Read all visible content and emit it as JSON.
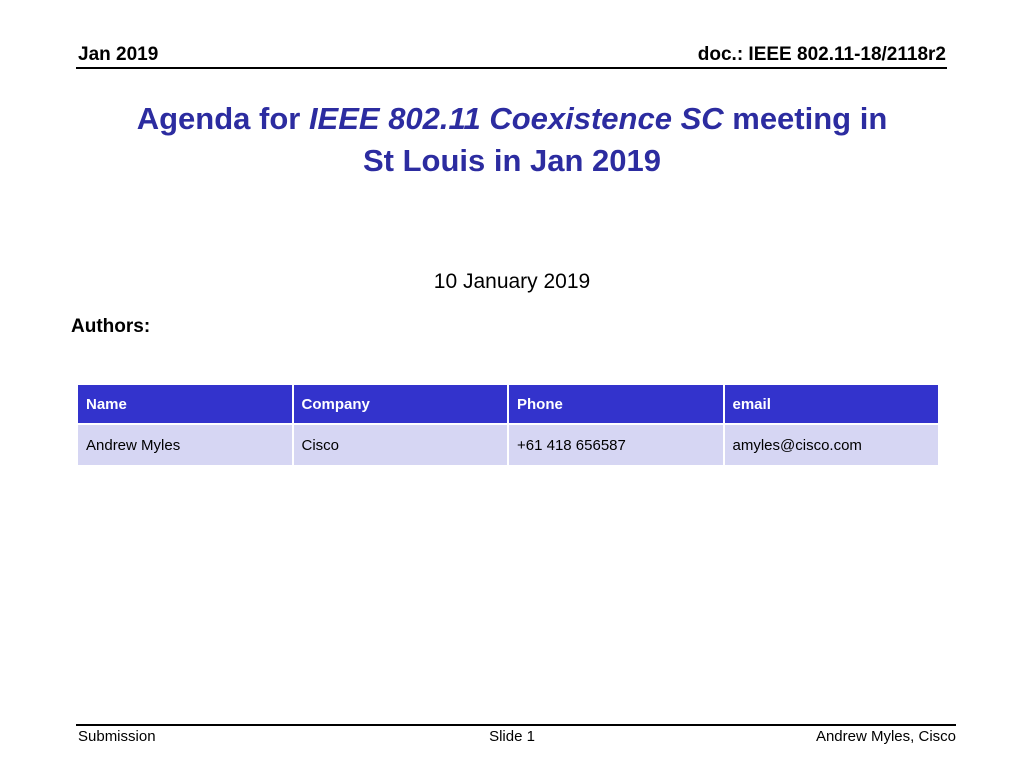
{
  "header": {
    "date": "Jan 2019",
    "doc_id": "doc.: IEEE 802.11-18/2118r2"
  },
  "title": {
    "prefix": "Agenda for ",
    "italic": "IEEE 802.11 Coexistence SC",
    "suffix": " meeting in",
    "line2": "St Louis in Jan 2019"
  },
  "date_line": "10 January 2019",
  "authors_label": "Authors:",
  "authors_table": {
    "columns": [
      "Name",
      "Company",
      "Phone",
      "email"
    ],
    "rows": [
      [
        "Andrew Myles",
        "Cisco",
        "+61 418 656587",
        "amyles@cisco.com"
      ]
    ]
  },
  "footer": {
    "left": "Submission",
    "center": "Slide 1",
    "right": "Andrew Myles, Cisco"
  },
  "colors": {
    "title": "#2c2ca0",
    "table_header": "#3333cc",
    "table_row": "#d6d6f3"
  }
}
